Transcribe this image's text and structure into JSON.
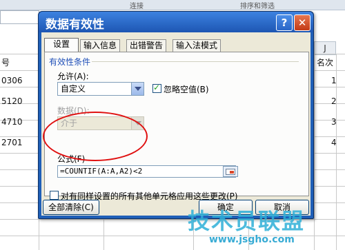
{
  "ribbon": {
    "groups": [
      "连接",
      "排序和筛选"
    ]
  },
  "sheet": {
    "left_header": "号",
    "left_values": [
      "0306",
      "5120",
      "4710",
      "2701"
    ],
    "right_col_label": "J",
    "right_header": "名次",
    "right_values": [
      "1",
      "2",
      "3",
      "4"
    ]
  },
  "dialog": {
    "title": "数据有效性",
    "help_glyph": "?",
    "close_glyph": "✕",
    "tabs": [
      "设置",
      "输入信息",
      "出错警告",
      "输入法模式"
    ],
    "group_label": "有效性条件",
    "allow_label": "允许(A):",
    "allow_value": "自定义",
    "ignore_blank_label": "忽略空值(B)",
    "ignore_blank_checked": true,
    "data_label": "数据(D):",
    "data_value": "介于",
    "formula_label": "公式(F)",
    "formula_value": "=COUNTIF(A:A,A2)<2",
    "apply_all_label": "对有同样设置的所有其他单元格应用这些更改(P)",
    "apply_all_checked": false,
    "clear_all_button": "全部清除(C)",
    "ok_button": "确定",
    "cancel_button": "取消"
  },
  "watermark": {
    "text": "技术员联盟",
    "url": "www.jsgho.com"
  },
  "colors": {
    "title_bar": "#1d56b3",
    "highlight_circle": "#e01010",
    "watermark": "#2fb0d8"
  }
}
